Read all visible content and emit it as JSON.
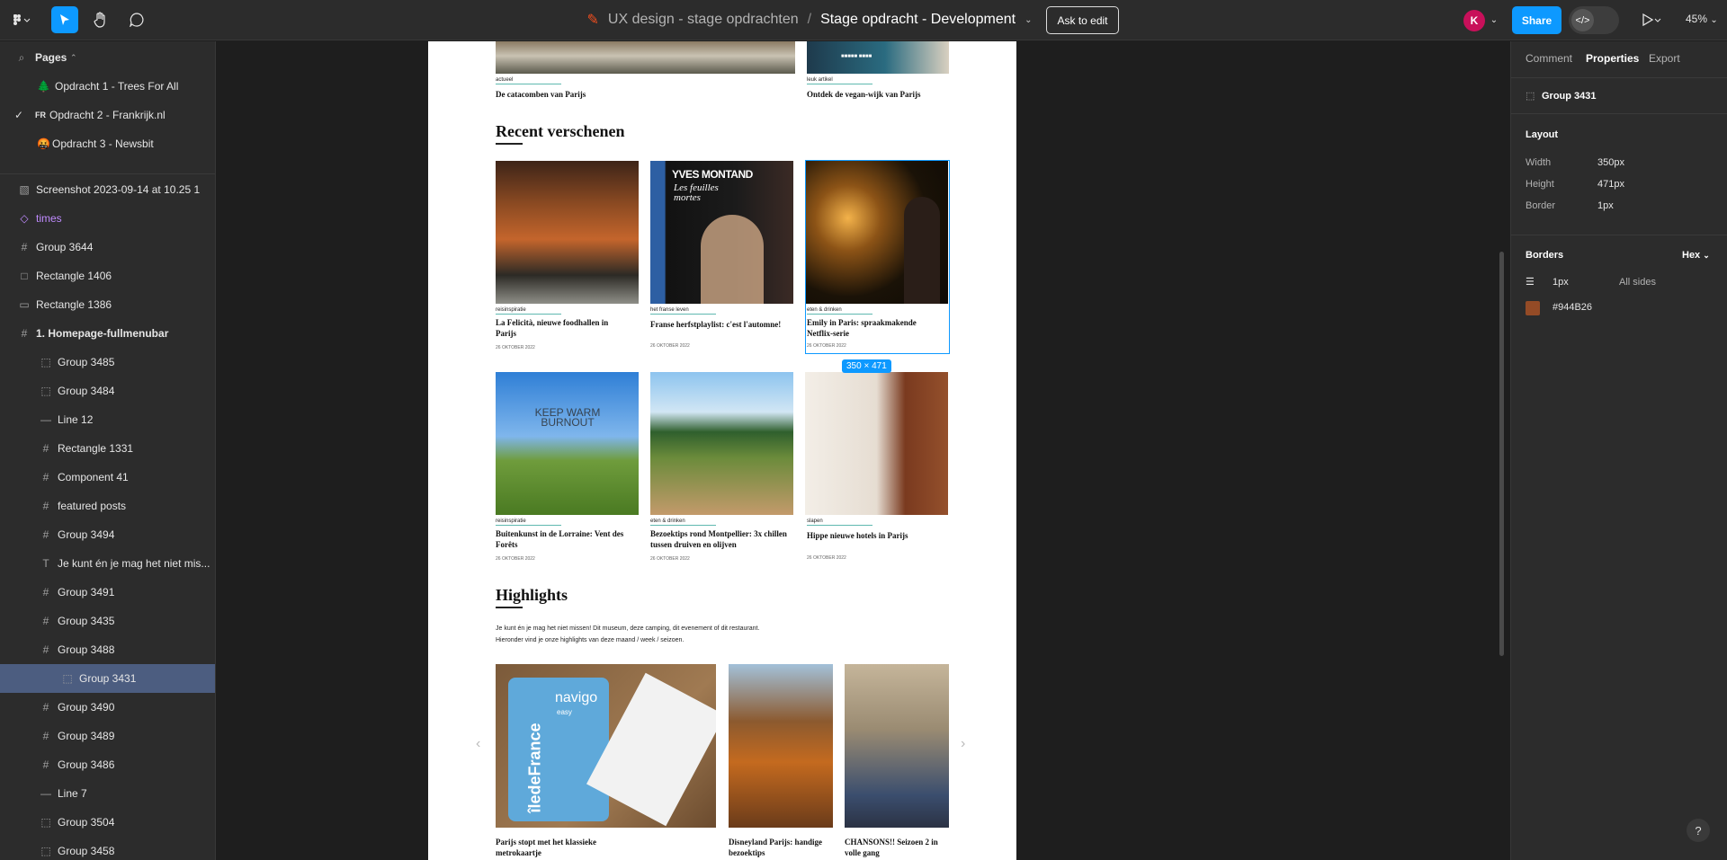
{
  "toolbar": {
    "project": "UX design - stage opdrachten",
    "separator": "/",
    "file": "Stage opdracht - Development",
    "ask_label": "Ask to edit",
    "avatar_initial": "K",
    "share_label": "Share",
    "dev_mode_glyph": "</>",
    "zoom": "45%"
  },
  "left": {
    "pages_header": "Pages",
    "pages": [
      {
        "emoji": "🌲",
        "label": "Opdracht 1 - Trees For All"
      },
      {
        "emoji": "FR",
        "label": "Opdracht 2 - Frankrijk.nl"
      },
      {
        "emoji": "🤬",
        "label": "Opdracht 3 - Newsbit"
      }
    ],
    "layers": [
      {
        "icon": "image-icon",
        "glyph": "▧",
        "label": "Screenshot 2023-09-14 at 10.25 1"
      },
      {
        "icon": "component-instance-icon",
        "glyph": "◇",
        "label": "times"
      },
      {
        "icon": "frame-icon",
        "glyph": "#",
        "label": "Group 3644"
      },
      {
        "icon": "rectangle-icon",
        "glyph": "□",
        "label": "Rectangle 1406"
      },
      {
        "icon": "rectangle-icon",
        "glyph": "▭",
        "label": "Rectangle 1386"
      },
      {
        "icon": "frame-icon",
        "glyph": "#",
        "label": "1. Homepage-fullmenubar"
      },
      {
        "icon": "group-icon",
        "glyph": "⬚",
        "label": "Group 3485"
      },
      {
        "icon": "group-icon",
        "glyph": "⬚",
        "label": "Group 3484"
      },
      {
        "icon": "line-icon",
        "glyph": "—",
        "label": "Line 12"
      },
      {
        "icon": "frame-icon",
        "glyph": "#",
        "label": "Rectangle 1331"
      },
      {
        "icon": "frame-icon",
        "glyph": "#",
        "label": "Component 41"
      },
      {
        "icon": "frame-icon",
        "glyph": "#",
        "label": "featured posts"
      },
      {
        "icon": "frame-icon",
        "glyph": "#",
        "label": "Group 3494"
      },
      {
        "icon": "text-icon",
        "glyph": "T",
        "label": "Je kunt én je mag het niet mis..."
      },
      {
        "icon": "frame-icon",
        "glyph": "#",
        "label": "Group 3491"
      },
      {
        "icon": "frame-icon",
        "glyph": "#",
        "label": "Group 3435"
      },
      {
        "icon": "frame-icon",
        "glyph": "#",
        "label": "Group 3488"
      },
      {
        "icon": "group-icon",
        "glyph": "⬚",
        "label": "Group 3431"
      },
      {
        "icon": "frame-icon",
        "glyph": "#",
        "label": "Group 3490"
      },
      {
        "icon": "frame-icon",
        "glyph": "#",
        "label": "Group 3489"
      },
      {
        "icon": "frame-icon",
        "glyph": "#",
        "label": "Group 3486"
      },
      {
        "icon": "line-icon",
        "glyph": "—",
        "label": "Line 7"
      },
      {
        "icon": "group-icon",
        "glyph": "⬚",
        "label": "Group 3504"
      },
      {
        "icon": "group-icon",
        "glyph": "⬚",
        "label": "Group 3458"
      }
    ]
  },
  "canvas": {
    "top_posts": [
      {
        "tag": "actueel",
        "title": "De catacomben van Parijs"
      },
      {
        "tag": "leuk artikel",
        "title": "Ontdek de vegan-wijk van Parijs"
      }
    ],
    "recent_heading": "Recent verschenen",
    "recent_posts": [
      {
        "tag": "reisinspiratie",
        "title": "La Felicità, nieuwe foodhallen in Parijs",
        "date": "26 OKTOBER 2022"
      },
      {
        "tag": "het franse leven",
        "title": "Franse herfstplaylist: c'est l'automne!",
        "date": "26 OKTOBER 2022"
      },
      {
        "tag": "eten & drinken",
        "title": "Emily in Paris: spraakmakende Netflix-serie",
        "date": "26 OKTOBER 2022"
      },
      {
        "tag": "reisinspiratie",
        "title": "Buitenkunst in de Lorraine: Vent des Forêts",
        "date": "26 OKTOBER 2022"
      },
      {
        "tag": "eten & drinken",
        "title": "Bezoektips rond Montpellier: 3x chillen tussen druiven en olijven",
        "date": "26 OKTOBER 2022"
      },
      {
        "tag": "slapen",
        "title": "Hippe nieuwe hotels in Parijs",
        "date": "26 OKTOBER 2022"
      }
    ],
    "album_text_1": "YVES MONTAND",
    "album_text_2": "Les feuilles mortes",
    "sign_text": "KEEP WARM BURNOUT",
    "selection_badge": "350 × 471",
    "highlights_heading": "Highlights",
    "highlights_text_1": "Je kunt én je mag het niet missen! Dit museum, deze camping, dit evenement of dit restaurant.",
    "highlights_text_2": "Hieronder vind je onze highlights van deze maand / week / seizoen.",
    "highlight_posts": [
      {
        "title": "Parijs stopt met het klassieke metrokaartje"
      },
      {
        "title": "Disneyland Parijs: handige bezoektips"
      },
      {
        "title": "CHANSONS!! Seizoen 2 in volle gang"
      }
    ],
    "navigo_text": "navigo",
    "navigo_sub": "easy",
    "idf_text": "îledeFrance"
  },
  "right": {
    "tabs": [
      "Comment",
      "Properties",
      "Export"
    ],
    "selection_name": "Group 3431",
    "layout_header": "Layout",
    "width_label": "Width",
    "width_value": "350px",
    "height_label": "Height",
    "height_value": "471px",
    "border_label": "Border",
    "border_value": "1px",
    "borders_header": "Borders",
    "color_format": "Hex",
    "border_weight": "1px",
    "border_sides": "All sides",
    "border_color": "#944B26",
    "help": "?"
  },
  "colors": {
    "accent": "#0d99ff",
    "border_swatch": "#944B26",
    "avatar": "#c8105a"
  }
}
